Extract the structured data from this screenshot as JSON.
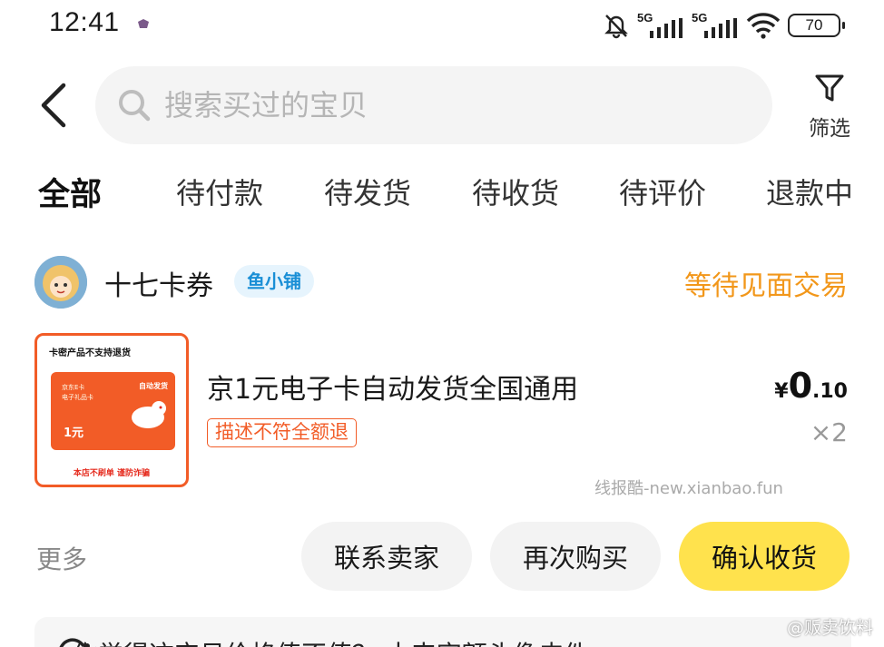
{
  "status_bar": {
    "time": "12:41",
    "sim1": "5G",
    "sim2": "5G",
    "battery": "70"
  },
  "header": {
    "search_placeholder": "搜索买过的宝贝",
    "filter_label": "筛选"
  },
  "tabs": [
    "全部",
    "待付款",
    "待发货",
    "待收货",
    "待评价",
    "退款中"
  ],
  "order": {
    "shop_name": "十七卡券",
    "shop_badge": "鱼小铺",
    "status": "等待见面交易",
    "thumb": {
      "top_text": "卡密产品不支持退货",
      "card_line1": "京东E卡",
      "card_line2": "电子礼品卡",
      "card_tag": "自动发货",
      "card_value": "1元",
      "bottom_text": "本店不刷单 谨防诈骗"
    },
    "title": "京1元电子卡自动发货全国通用",
    "refund_tag": "描述不符全额退",
    "price_symbol": "¥",
    "price_int": "0",
    "price_dec": ".10",
    "quantity": "×2",
    "watermark": "线报酷-new.xianbao.fun"
  },
  "actions": {
    "more": "更多",
    "contact": "联系卖家",
    "rebuy": "再次购买",
    "confirm": "确认收货"
  },
  "teaser": {
    "text": "你觉得这宝贝价格值不值？ 十来字额头像皮件"
  },
  "weibo_watermark": "@贩卖饮料"
}
